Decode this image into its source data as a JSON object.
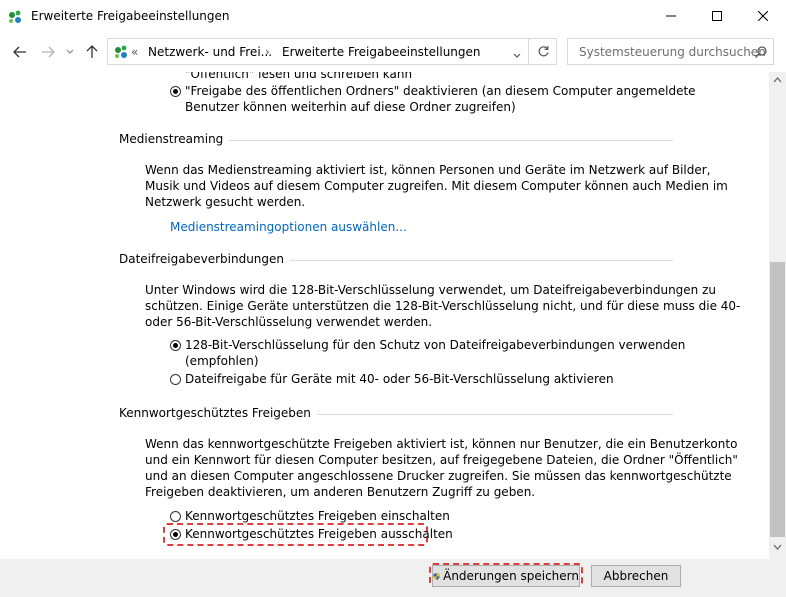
{
  "window": {
    "title": "Erweiterte Freigabeeinstellungen",
    "icons": [
      "network-app-icon",
      "minimize-icon",
      "maximize-icon",
      "close-icon"
    ]
  },
  "nav": {
    "breadcrumb_prefix": "«",
    "crumbs": [
      "Netzwerk- und Frei...",
      "Erweiterte Freigabeeinstellungen"
    ],
    "separator": "›",
    "search_placeholder": "Systemsteuerung durchsuchen"
  },
  "public_folders": {
    "partial_option": "\"Öffentlich\" lesen und schreiben kann",
    "off_option_line1": "\"Freigabe des öffentlichen Ordners\" deaktivieren (an diesem Computer angemeldete",
    "off_option_line2": "Benutzer können weiterhin auf diese Ordner zugreifen)"
  },
  "media": {
    "title": "Medienstreaming",
    "desc": [
      "Wenn das Medienstreaming aktiviert ist, können Personen und Geräte im Netzwerk auf Bilder,",
      "Musik und Videos auf diesem Computer zugreifen. Mit diesem Computer können auch Medien im",
      "Netzwerk gesucht werden."
    ],
    "link": "Medienstreamingoptionen auswählen..."
  },
  "file_sharing": {
    "title": "Dateifreigabeverbindungen",
    "desc": [
      "Unter Windows wird die 128-Bit-Verschlüsselung verwendet, um Dateifreigabeverbindungen zu",
      "schützen. Einige Geräte unterstützen die 128-Bit-Verschlüsselung nicht, und für diese muss die 40-",
      "oder 56-Bit-Verschlüsselung verwendet werden."
    ],
    "option1_line1": "128-Bit-Verschlüsselung für den Schutz von Dateifreigabeverbindungen verwenden",
    "option1_line2": "(empfohlen)",
    "option2": "Dateifreigabe für Geräte mit 40- oder 56-Bit-Verschlüsselung aktivieren"
  },
  "password": {
    "title": "Kennwortgeschütztes Freigeben",
    "desc": [
      "Wenn das kennwortgeschützte Freigeben aktiviert ist, können nur Benutzer, die ein Benutzerkonto",
      "und ein Kennwort für diesen Computer besitzen, auf freigegebene Dateien, die Ordner \"Öffentlich\"",
      "und an diesen Computer angeschlossene Drucker zugreifen. Sie müssen das kennwortgeschützte",
      "Freigeben deaktivieren, um anderen Benutzern Zugriff zu geben."
    ],
    "option_on": "Kennwortgeschütztes Freigeben einschalten",
    "option_off": "Kennwortgeschütztes Freigeben ausschalten"
  },
  "footer": {
    "save_label": "Änderungen speichern",
    "cancel_label": "Abbrechen"
  },
  "colors": {
    "link": "#0066cc",
    "highlight": "#e03c3c",
    "shield_blue": "#2a62c9",
    "shield_yellow": "#f2c200"
  }
}
